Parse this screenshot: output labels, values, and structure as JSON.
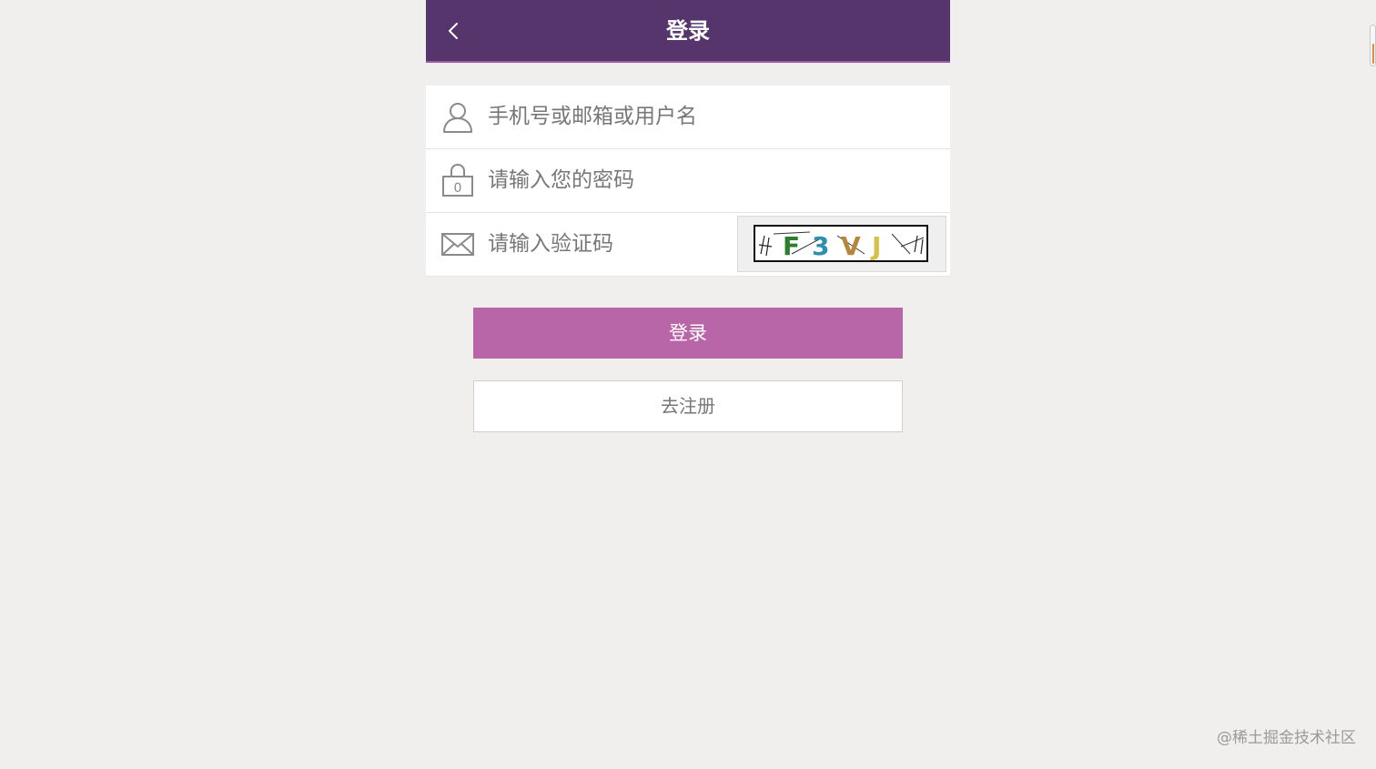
{
  "header": {
    "title": "登录",
    "back_icon": "chevron-left-icon",
    "background_color": "#55356c"
  },
  "form": {
    "username": {
      "placeholder": "手机号或邮箱或用户名",
      "value": "",
      "icon": "user-icon"
    },
    "password": {
      "placeholder": "请输入您的密码",
      "value": "",
      "icon": "lock-icon"
    },
    "captcha": {
      "placeholder": "请输入验证码",
      "value": "",
      "icon": "envelope-icon",
      "image_text": "F3VJ"
    }
  },
  "actions": {
    "login_label": "登录",
    "login_color": "#b866a8",
    "register_label": "去注册"
  },
  "watermark": "@稀土掘金技术社区"
}
